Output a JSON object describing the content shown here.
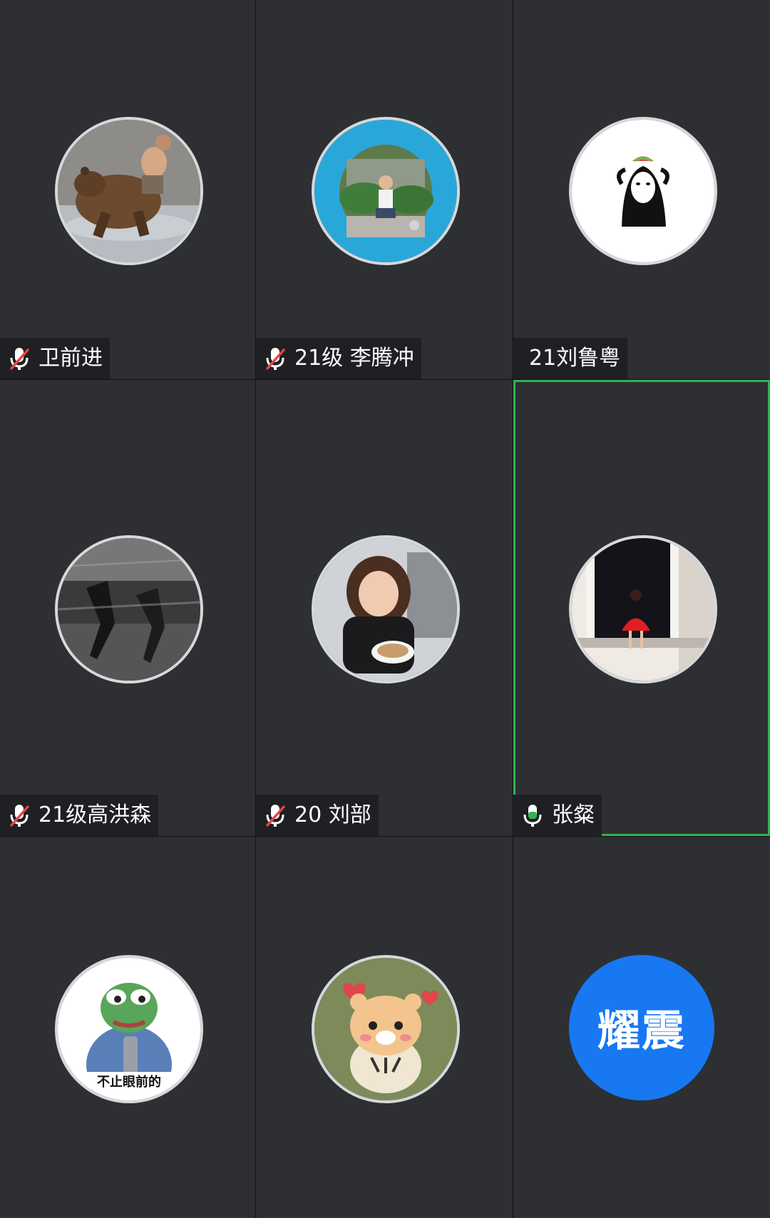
{
  "participants": [
    {
      "name": "卫前进",
      "mic": "muted",
      "avatar": "bear-rider-photo"
    },
    {
      "name": "21级 李腾冲",
      "mic": "muted",
      "avatar": "man-sitting-garden-photo"
    },
    {
      "name": "21刘鲁粤",
      "mic": "none",
      "avatar": "no-face-cartoon"
    },
    {
      "name": "21级高洪森",
      "mic": "muted",
      "avatar": "running-figures-bw-photo"
    },
    {
      "name": "20 刘部",
      "mic": "muted",
      "avatar": "girl-with-coffee-photo"
    },
    {
      "name": "张粲",
      "mic": "active",
      "avatar": "girl-red-dress-window-photo"
    },
    {
      "name": "",
      "mic": "none",
      "avatar": "pepe-frog-meme",
      "avatar_caption": "不止眼前的"
    },
    {
      "name": "",
      "mic": "none",
      "avatar": "tiger-cartoon"
    },
    {
      "name": "",
      "mic": "none",
      "avatar": "text-avatar",
      "avatar_text": "耀震"
    }
  ],
  "colors": {
    "tile_bg": "#2d2f33",
    "grid_line": "#111214",
    "speaking_border": "#2fb54f",
    "mute_slash": "#e94545",
    "mic_active": "#2fb54f",
    "text_avatar_bg": "#1778f2"
  }
}
